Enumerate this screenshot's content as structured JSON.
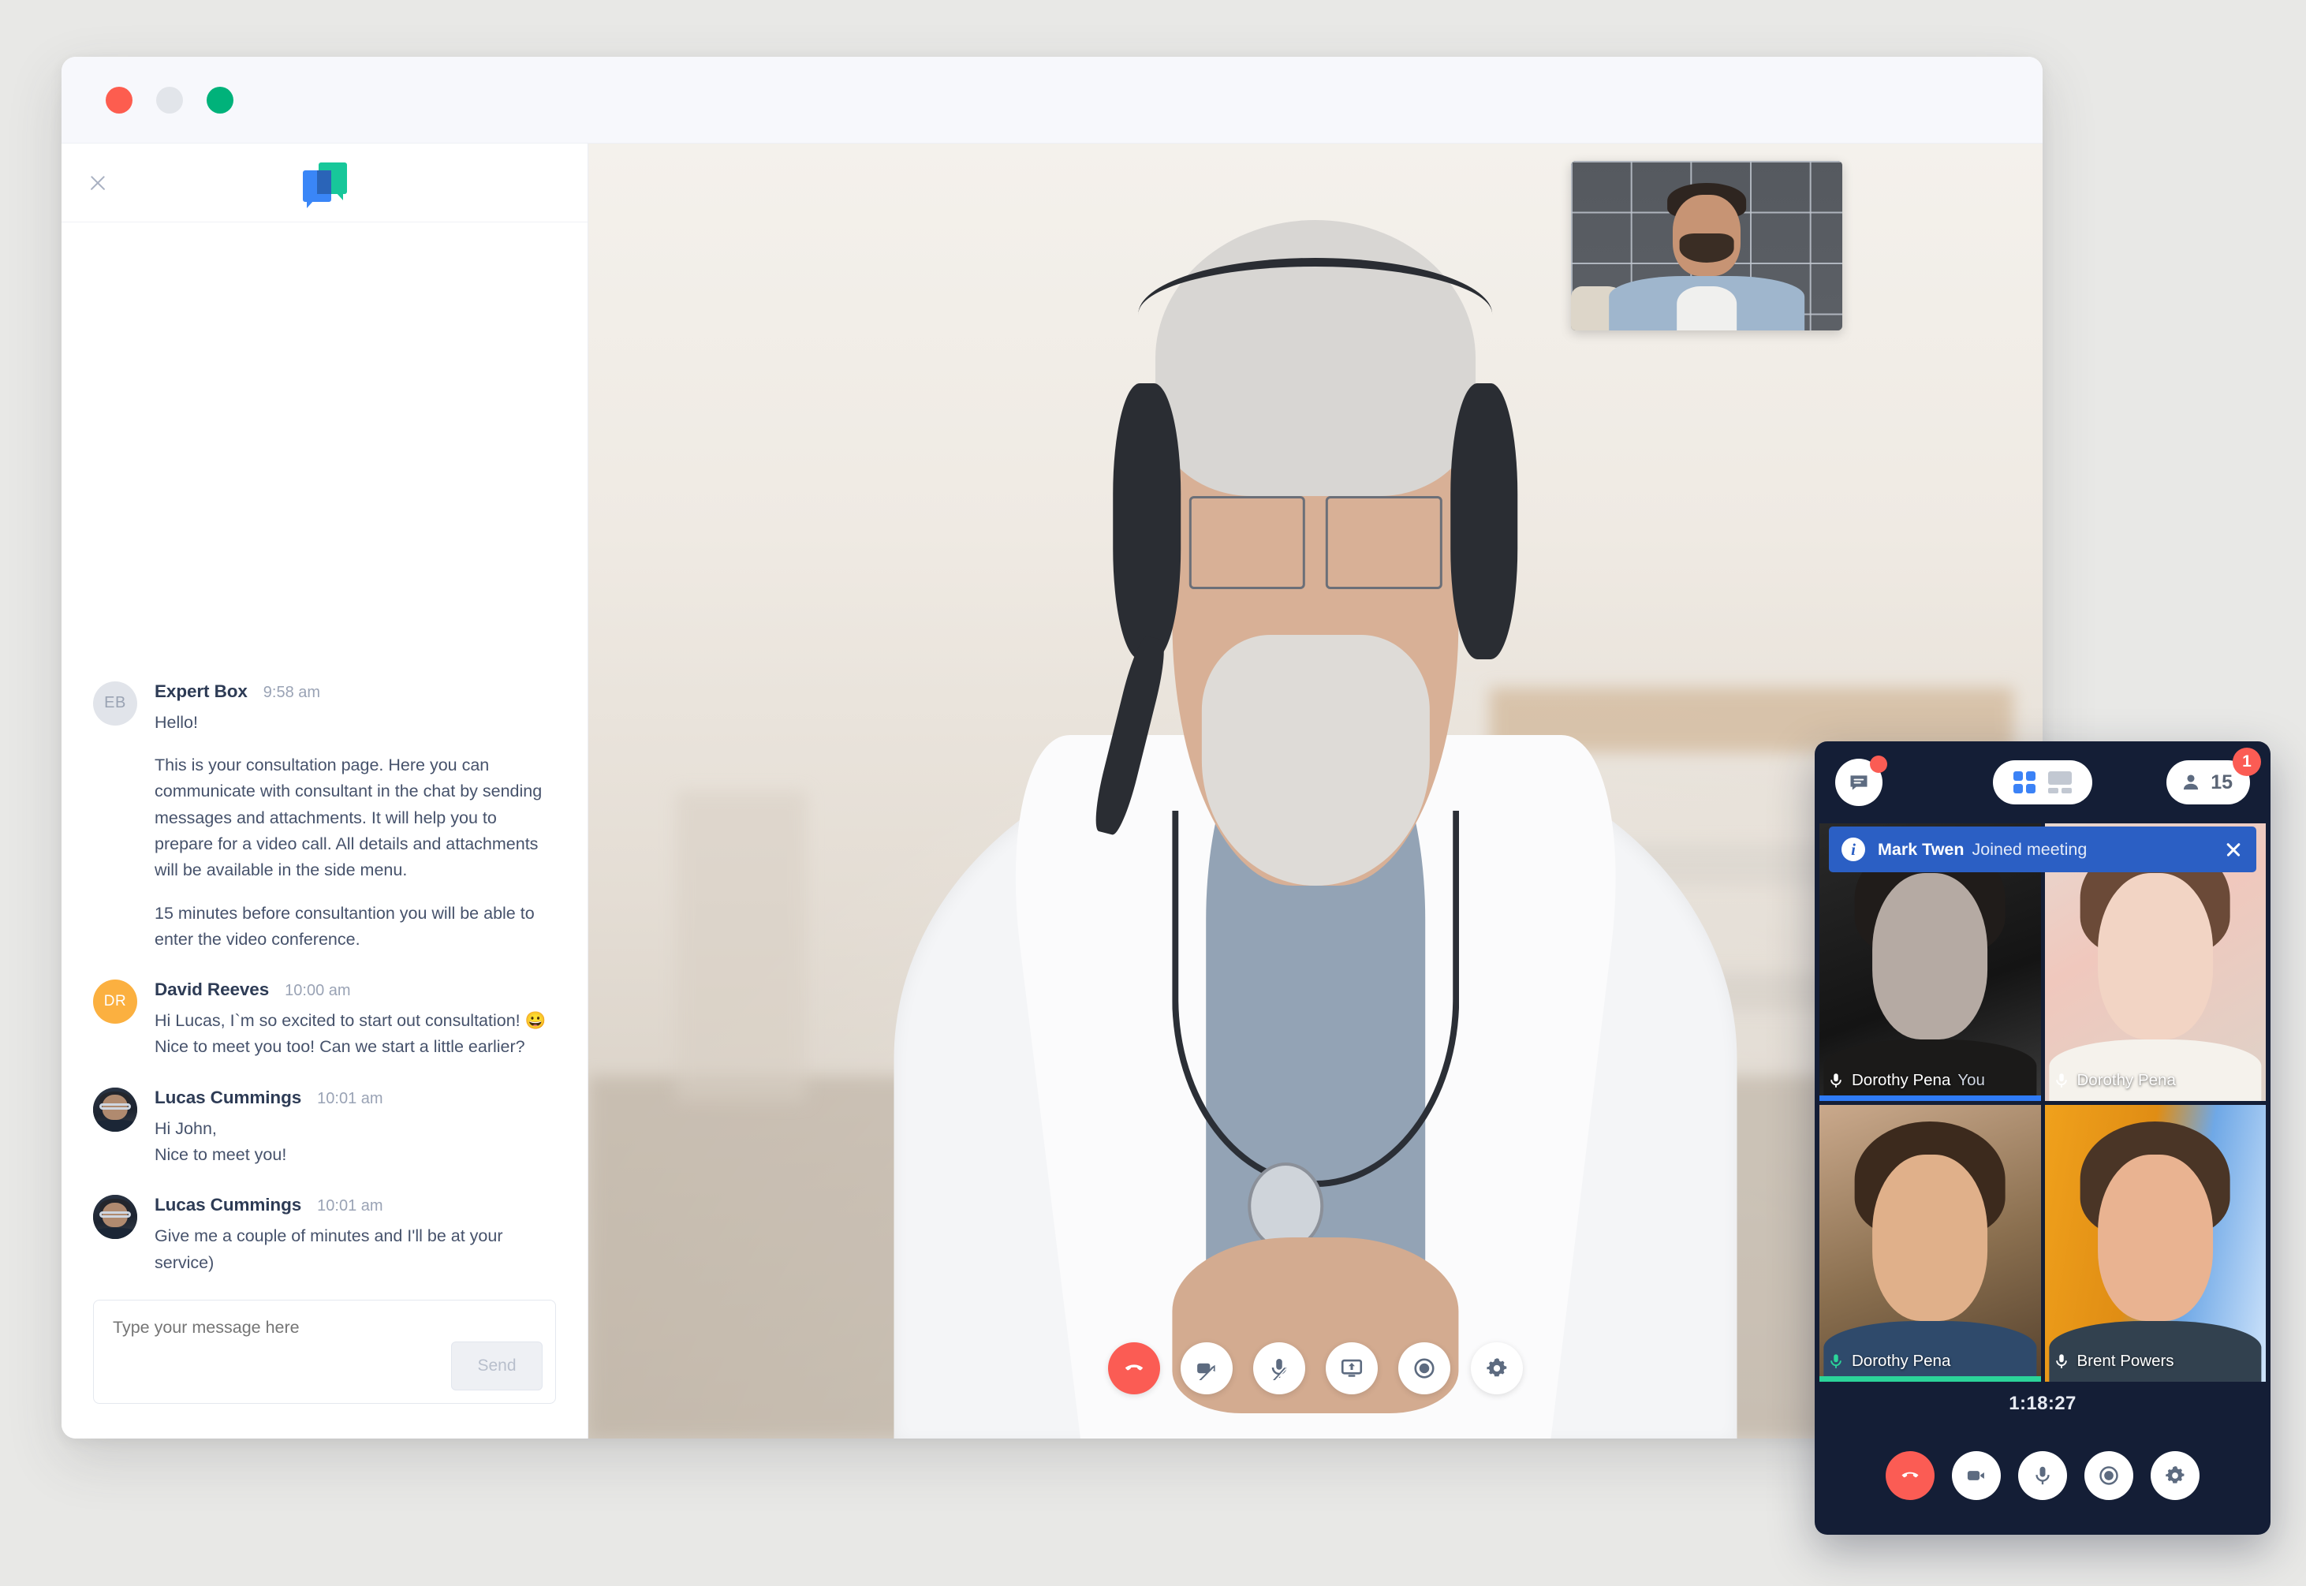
{
  "window": {
    "traffic_lights": [
      "close",
      "minimize",
      "maximize"
    ]
  },
  "sidebar": {
    "close_label": "×",
    "logo_name": "expertbox-logo",
    "messages": [
      {
        "author": "Expert Box",
        "time": "9:58 am",
        "avatar_type": "initials",
        "initials": "EB",
        "paragraphs": [
          "Hello!",
          "This is your consultation page. Here you can communicate with consultant in the chat by sending messages and attachments. It will help you to prepare for a video call. All details and attachments will be available in the side menu.",
          "15 minutes before consultantion you will be able to enter the video conference."
        ]
      },
      {
        "author": "David Reeves",
        "time": "10:00 am",
        "avatar_type": "initials",
        "initials": "DR",
        "paragraphs": [
          "Hi Lucas, I`m so excited to start out consultation! 😀",
          "Nice to meet you too! Can we start a little earlier?"
        ]
      },
      {
        "author": "Lucas Cummings",
        "time": "10:01 am",
        "avatar_type": "photo",
        "initials": "",
        "paragraphs": [
          "Hi John,",
          "Nice to meet you!"
        ]
      },
      {
        "author": "Lucas Cummings",
        "time": "10:01 am",
        "avatar_type": "photo",
        "initials": "",
        "paragraphs": [
          "Give me a couple of minutes and I'll be at your service)"
        ]
      }
    ],
    "composer": {
      "placeholder": "Type your message here",
      "value": "",
      "send_label": "Send"
    }
  },
  "stage": {
    "controls": [
      {
        "name": "hang-up",
        "icon": "phone-hangup-icon"
      },
      {
        "name": "camera-off",
        "icon": "video-slash-icon"
      },
      {
        "name": "microphone-off",
        "icon": "microphone-slash-icon"
      },
      {
        "name": "share-screen",
        "icon": "screen-share-icon"
      },
      {
        "name": "record",
        "icon": "record-icon"
      },
      {
        "name": "settings",
        "icon": "gear-icon"
      }
    ]
  },
  "conference": {
    "chat_button": {
      "name": "conference-chat",
      "has_unread": true
    },
    "layout_toggle": {
      "grid_active": true,
      "options": [
        "grid-view",
        "speaker-view"
      ]
    },
    "participants": {
      "count": "15",
      "badge": "1"
    },
    "notice": {
      "name": "Mark Twen",
      "text": "Joined meeting",
      "close_label": "×"
    },
    "tiles": [
      {
        "name": "Dorothy Pena",
        "suffix": "You",
        "mic_state": "muted",
        "bar": "blue"
      },
      {
        "name": "Dorothy Pena",
        "suffix": "",
        "mic_state": "muted",
        "bar": "none"
      },
      {
        "name": "Dorothy Pena",
        "suffix": "",
        "mic_state": "active",
        "bar": "green"
      },
      {
        "name": "Brent Powers",
        "suffix": "",
        "mic_state": "muted",
        "bar": "none"
      }
    ],
    "timer": "1:18:27",
    "controls": [
      {
        "name": "hang-up",
        "icon": "phone-hangup-icon"
      },
      {
        "name": "camera",
        "icon": "video-icon"
      },
      {
        "name": "microphone",
        "icon": "microphone-icon"
      },
      {
        "name": "record",
        "icon": "record-icon"
      },
      {
        "name": "settings",
        "icon": "gear-icon"
      }
    ]
  },
  "colors": {
    "accent_blue": "#3b82f6",
    "danger_red": "#fb5c54",
    "active_green": "#2bd49a",
    "panel_dark": "#141e36",
    "notice_blue": "#2b5fc4"
  }
}
